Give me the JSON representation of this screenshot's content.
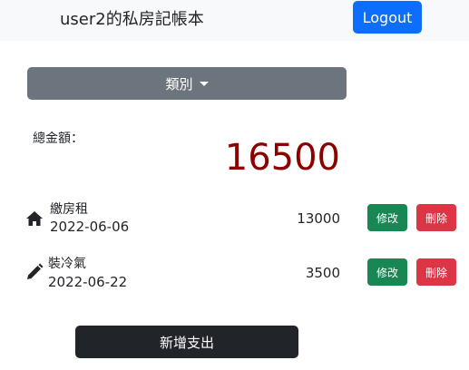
{
  "navbar": {
    "brand": "user2的私房記帳本",
    "logout_label": "Logout"
  },
  "category": {
    "label": "類別"
  },
  "total": {
    "label": "總金額：",
    "amount": "16500"
  },
  "records": [
    {
      "icon": "home-icon",
      "name": "繳房租",
      "date": "2022-06-06",
      "amount": "13000",
      "edit_label": "修改",
      "delete_label": "刪除"
    },
    {
      "icon": "pencil-icon",
      "name": "裝冷氣",
      "date": "2022-06-22",
      "amount": "3500",
      "edit_label": "修改",
      "delete_label": "刪除"
    }
  ],
  "add_expense_label": "新增支出",
  "colors": {
    "primary": "#0d6efd",
    "secondary": "#6c757d",
    "success": "#198754",
    "danger": "#dc3545",
    "dark": "#212529",
    "total_amount": "#8b0000"
  }
}
